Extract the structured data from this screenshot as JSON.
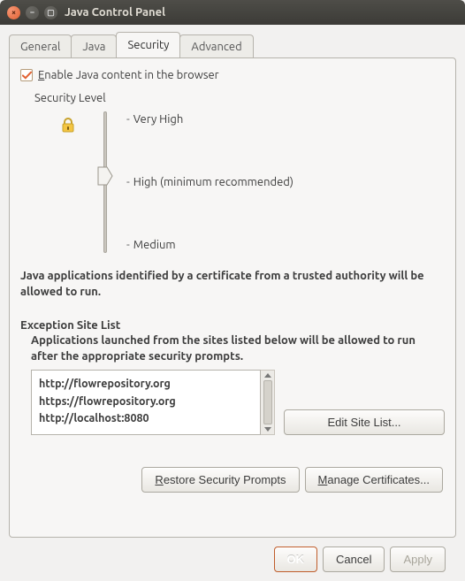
{
  "window": {
    "title": "Java Control Panel"
  },
  "tabs": {
    "general": "General",
    "java": "Java",
    "security": "Security",
    "advanced": "Advanced",
    "active": "security"
  },
  "security": {
    "enable_checkbox": {
      "prefix": "E",
      "rest": "nable Java content in the browser",
      "checked": true
    },
    "level_label": "Security Level",
    "levels": {
      "very_high": "Very High",
      "high": "High (minimum recommended)",
      "medium": "Medium",
      "selected": "high"
    },
    "description": "Java applications identified by a certificate from a trusted authority will be allowed to run.",
    "exception": {
      "heading": "Exception Site List",
      "note": "Applications launched from the sites listed below will be allowed to run after the appropriate security prompts.",
      "sites": [
        "http://flowrepository.org",
        "https://flowrepository.org",
        "http://localhost:8080"
      ],
      "edit_button": "Edit Site List..."
    },
    "buttons": {
      "restore_prefix": "R",
      "restore_rest": "estore Security Prompts",
      "manage_prefix": "M",
      "manage_rest": "anage Certificates..."
    }
  },
  "footer": {
    "ok": "OK",
    "cancel": "Cancel",
    "apply": "Apply"
  }
}
